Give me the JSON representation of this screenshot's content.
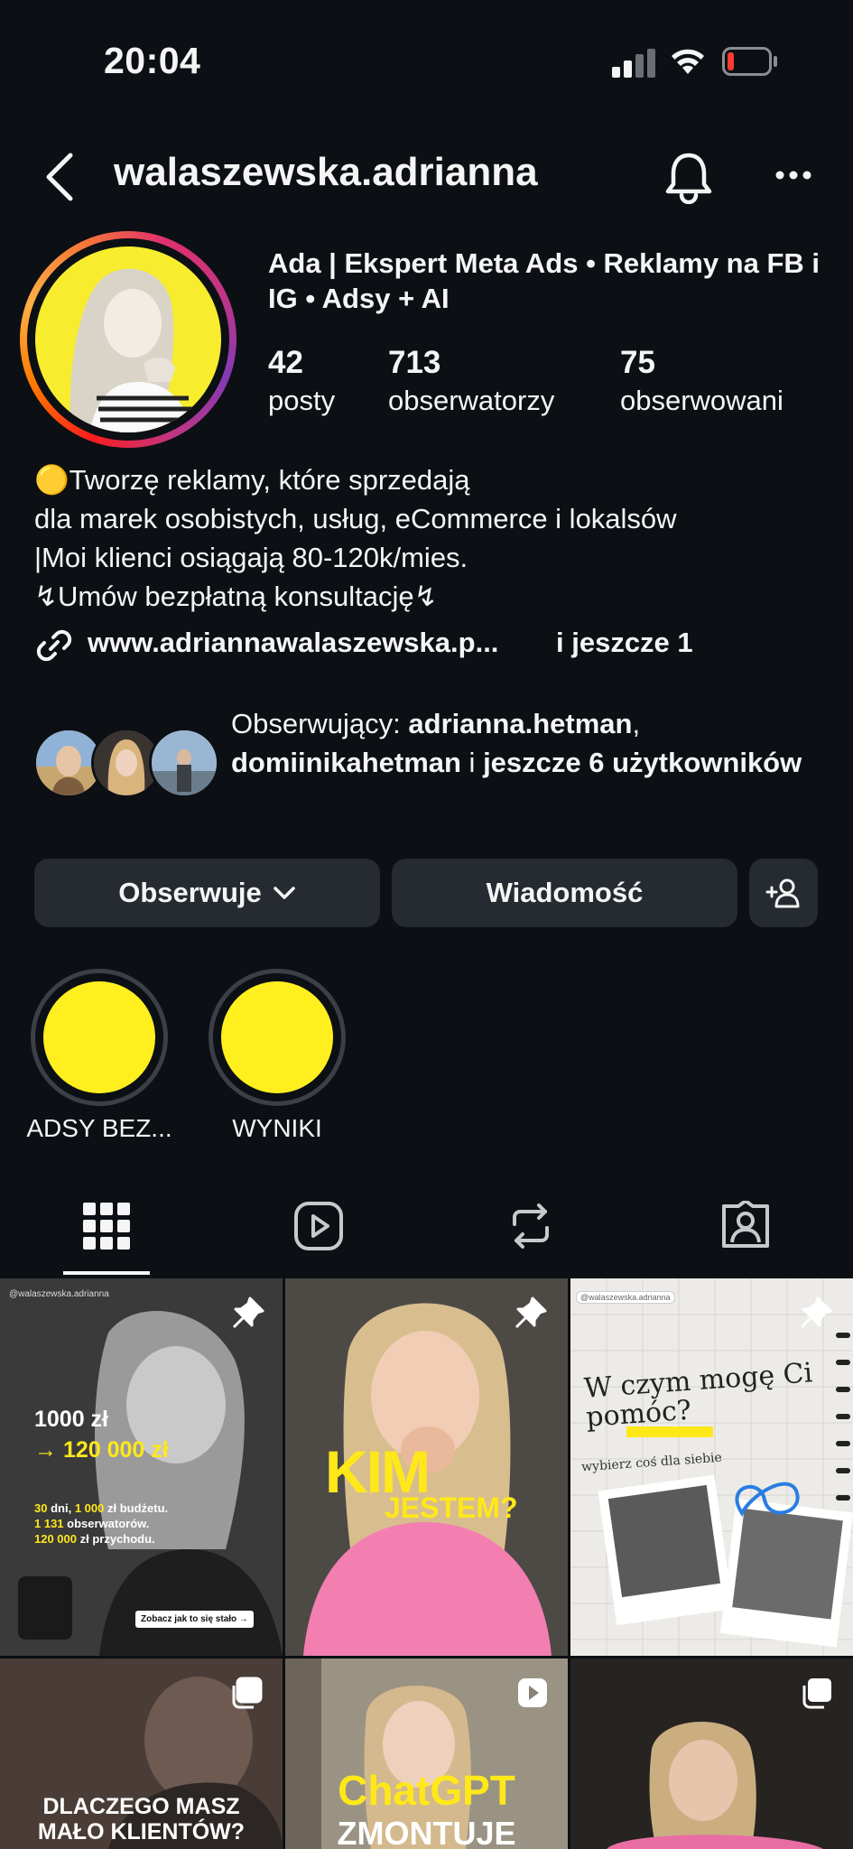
{
  "status_bar": {
    "time": "20:04"
  },
  "header": {
    "username": "walaszewska.adrianna"
  },
  "profile": {
    "full_name": "Ada | Ekspert Meta Ads • Reklamy na FB i IG • Adsy + AI",
    "stats": [
      {
        "value": "42",
        "label": "posty"
      },
      {
        "value": "713",
        "label": "obserwatorzy"
      },
      {
        "value": "75",
        "label": "obserwowani"
      }
    ],
    "bio": [
      "🟡Tworzę reklamy, które sprzedają",
      "dla marek osobistych, usług, eCommerce i lokalsów",
      "|Moi klienci osiągają 80-120k/mies.",
      "↯Umów bezpłatną konsultację↯"
    ],
    "link": "www.adriannawalaszewska.p...",
    "link_more": "i jeszcze 1"
  },
  "followed_by": {
    "prefix": "Obserwujący: ",
    "user1": "adrianna.hetman",
    "sep": ",",
    "user2": "domiinikahetman",
    "and": " i ",
    "rest": "jeszcze 6 użytkowników"
  },
  "buttons": {
    "follow": "Obserwuje",
    "message": "Wiadomość"
  },
  "highlights": [
    {
      "label": "ADSY BEZ..."
    },
    {
      "label": "WYNIKI"
    }
  ],
  "tabs": [
    {
      "icon": "grid-icon"
    },
    {
      "icon": "reels-icon"
    },
    {
      "icon": "reposts-icon"
    },
    {
      "icon": "tagged-icon"
    }
  ],
  "posts": {
    "p1": {
      "handle": "@walaszewska.adrianna",
      "line1": "1000 zł",
      "line2": "→ 120 000 zł",
      "d1a": "30",
      "d1b": " dni, ",
      "d1c": "1 000",
      "d1d": " zł budżetu.",
      "d2a": "1 131",
      "d2b": " obserwatorów.",
      "d3a": "120 000",
      "d3b": " zł przychodu.",
      "cta": "Zobacz jak to się stało →"
    },
    "p2": {
      "line1": "KIM",
      "line2": "JESTEM?"
    },
    "p3": {
      "handle": "@walaszewska.adrianna",
      "title1": "W czym mogę Ci",
      "title2": "pomóc?",
      "sub": "wybierz coś dla siebie"
    },
    "p4": {
      "line1": "DLACZEGO MASZ",
      "line2": "MAŁO KLIENTÓW?"
    },
    "p5": {
      "line1": "ChatGPT",
      "line2": "ZMONTUJE"
    }
  },
  "colors": {
    "background": "#0c1014",
    "button": "#262a31",
    "highlight_yellow": "#ffef1f",
    "text": "#f5f5f5",
    "battery_low": "#ff3b30"
  }
}
